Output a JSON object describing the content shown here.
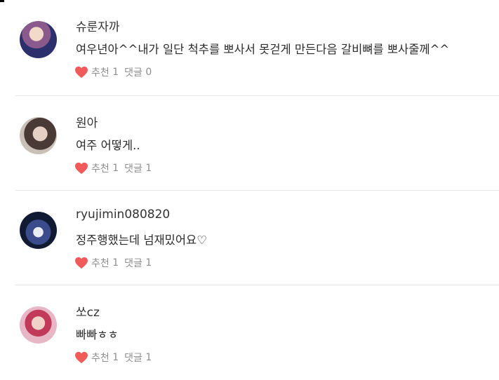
{
  "colors": {
    "heart": "#f05a5a",
    "meta_text": "#8e8e8e",
    "divider": "#e6e6e6"
  },
  "labels": {
    "like": "추천",
    "reply": "댓글"
  },
  "comments": [
    {
      "username": "슈룬자까",
      "text": "여우년아^^내가 일단 척추를 뽀사서 못걷게 만든다음 갈비뼈를 뽀사줄께^^",
      "likes": "1",
      "replies": "0"
    },
    {
      "username": "원아",
      "text": "여주 어떻게..",
      "likes": "1",
      "replies": "1"
    },
    {
      "username": "ryujimin080820",
      "text": "정주행했는데 넘재밌어요♡",
      "likes": "1",
      "replies": "1"
    },
    {
      "username": "쏘cz",
      "text": "빠빠ㅎㅎ",
      "likes": "1",
      "replies": "1"
    }
  ]
}
